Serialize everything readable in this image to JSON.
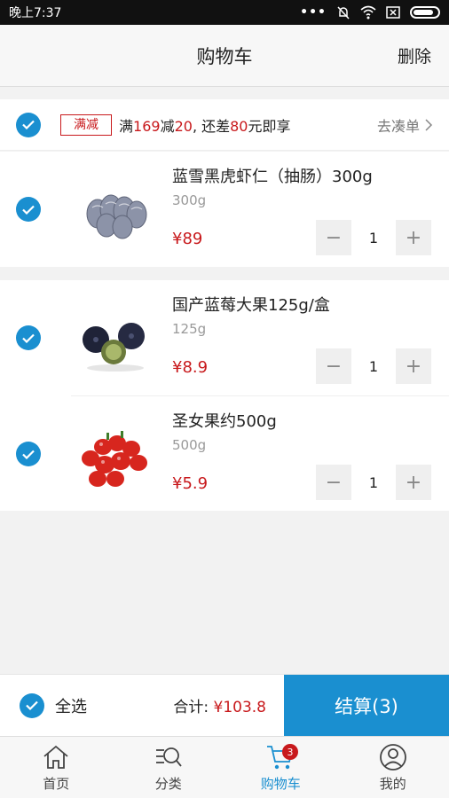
{
  "status_bar": {
    "time": "晚上7:37",
    "dots": "•••"
  },
  "header": {
    "title": "购物车",
    "delete_label": "删除"
  },
  "promo": {
    "tag": "满减",
    "text_prefix": "满",
    "threshold": "169",
    "text_mid1": "减",
    "discount": "20",
    "text_mid2": ", 还差",
    "remaining": "80",
    "text_suffix": "元即享",
    "go_label": "去凑单"
  },
  "items": [
    {
      "name": "蓝雪黑虎虾仁（抽肠）300g",
      "spec": "300g",
      "price": "¥89",
      "qty": "1",
      "image": "shrimp"
    },
    {
      "name": "国产蓝莓大果125g/盒",
      "spec": "125g",
      "price": "¥8.9",
      "qty": "1",
      "image": "blueberry"
    },
    {
      "name": "圣女果约500g",
      "spec": "500g",
      "price": "¥5.9",
      "qty": "1",
      "image": "cherry-tomato"
    }
  ],
  "stepper": {
    "minus": "−",
    "plus": "+"
  },
  "checkout": {
    "select_all": "全选",
    "total_label": "合计: ",
    "total_amount": "¥103.8",
    "button": "结算(3)"
  },
  "tabs": [
    {
      "label": "首页",
      "icon": "home-icon"
    },
    {
      "label": "分类",
      "icon": "category-search-icon"
    },
    {
      "label": "购物车",
      "icon": "cart-icon",
      "badge": "3",
      "active": true
    },
    {
      "label": "我的",
      "icon": "profile-icon"
    }
  ],
  "colors": {
    "accent": "#1a8fd0",
    "price": "#c8191c"
  }
}
